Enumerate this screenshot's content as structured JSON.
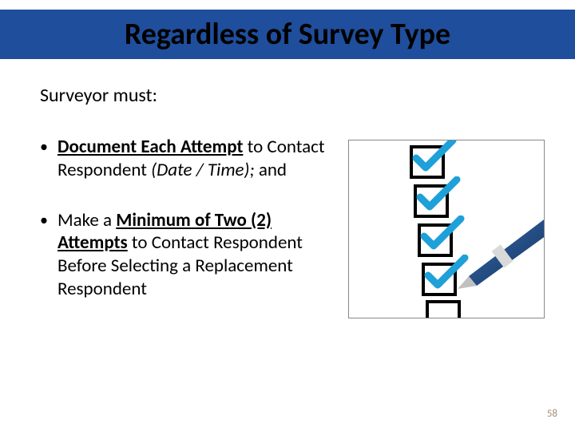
{
  "title": "Regardless of Survey Type",
  "subheading": "Surveyor must:",
  "bullets": [
    {
      "lead_bold_underline": "Document Each Attempt",
      "mid_plain": " to Contact Respondent ",
      "trail_italic": "(Date / Time);",
      "tail_plain": " and"
    },
    {
      "lead_plain": "Make a ",
      "mid_bold_underline": "Minimum of Two (2) Attempts",
      "trail_plain": " to Contact Respondent Before Selecting a Replacement Respondent"
    }
  ],
  "image_alt": "checklist-with-pen-icon",
  "page_number": "58"
}
